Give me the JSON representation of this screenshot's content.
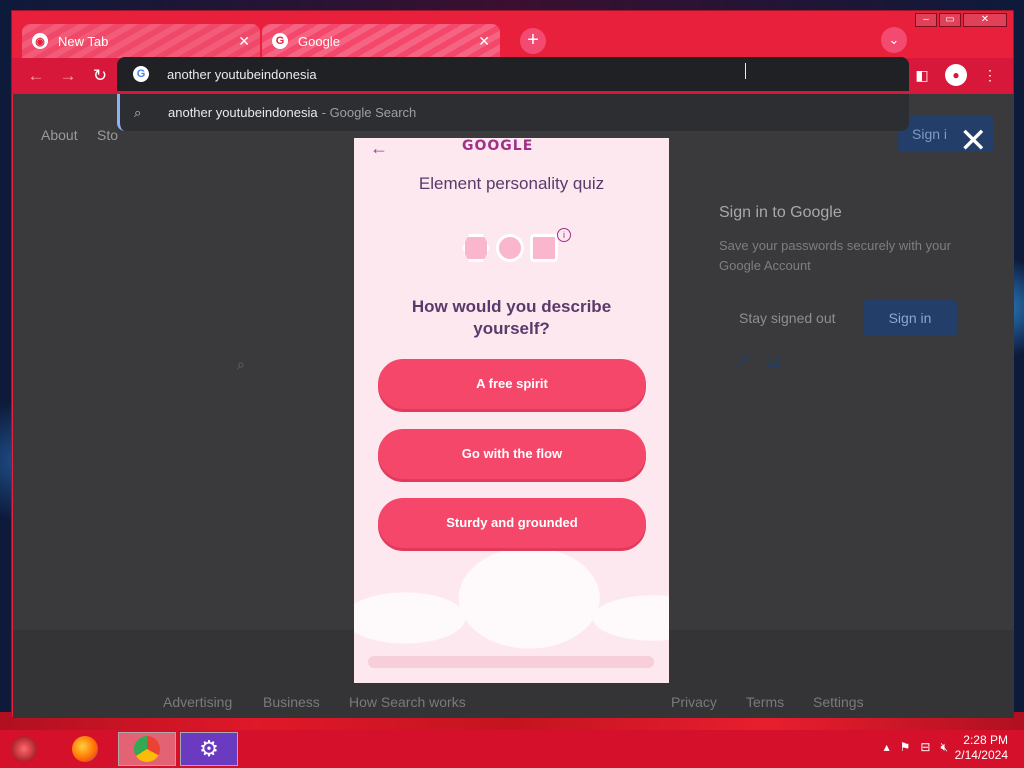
{
  "browser": {
    "tabs": [
      {
        "title": "New Tab",
        "active": false
      },
      {
        "title": "Google",
        "active": true
      }
    ],
    "new_tab_label": "+",
    "omnibox_value": "another youtubeindonesia",
    "suggestion": {
      "query": "another youtubeindonesia",
      "source": "- Google Search"
    }
  },
  "page": {
    "top_links": [
      "About",
      "Sto"
    ],
    "sign_in_top": "Sign i",
    "signin_card": {
      "title": "Sign in to Google",
      "description": "Save your passwords securely with your Google Account",
      "stay_signed_out": "Stay signed out",
      "sign_in": "Sign in"
    },
    "footer_links": [
      "Advertising",
      "Business",
      "How Search works",
      "Privacy",
      "Terms",
      "Settings"
    ]
  },
  "quiz": {
    "logo": "GOOGLE",
    "title": "Element personality quiz",
    "question": "How would you describe yourself?",
    "answers": [
      "A free spirit",
      "Go with the flow",
      "Sturdy and grounded"
    ],
    "progress": 0
  },
  "taskbar": {
    "time": "2:28 PM",
    "date": "2/14/2024"
  },
  "colors": {
    "browser_frame": "#e8203c",
    "answer_button": "#f5476a",
    "quiz_bg": "#fde8ef",
    "taskbar": "#d4102a"
  }
}
